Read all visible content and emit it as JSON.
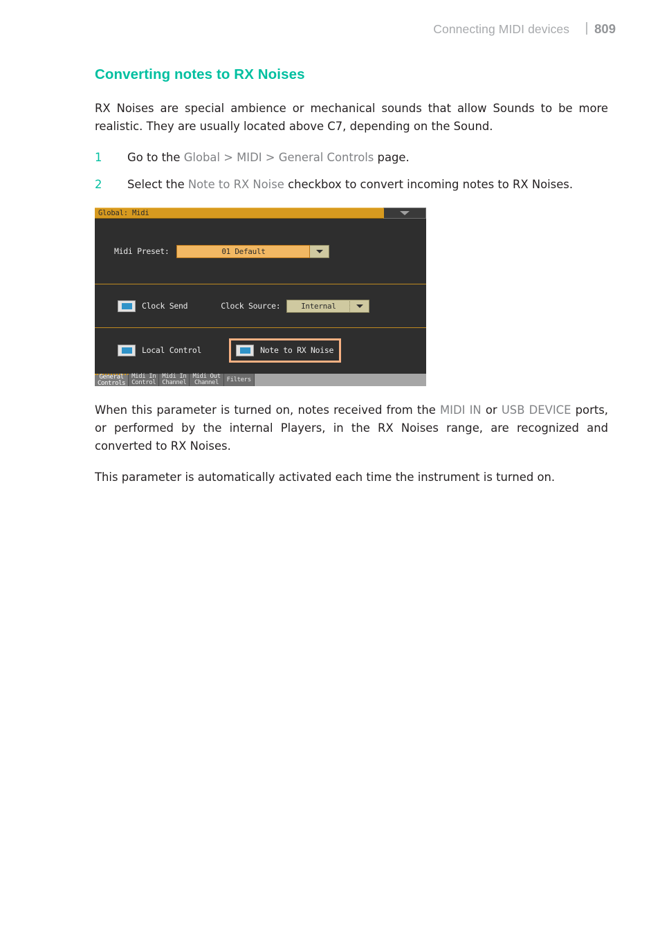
{
  "header": {
    "title": "Connecting MIDI devices",
    "page_number": "809"
  },
  "section": {
    "heading": "Converting notes to RX Noises",
    "heading_color": "#00bfa0",
    "intro": "RX Noises are special ambience or mechanical sounds that allow Sounds to be more realistic. They are usually located above C7, depending on the Sound."
  },
  "steps": [
    {
      "number": "1",
      "prefix": "Go to the ",
      "term": "Global > MIDI > General Controls",
      "suffix": " page."
    },
    {
      "number": "2",
      "prefix": "Select the ",
      "term": "Note to RX Noise",
      "suffix": " checkbox to convert incoming notes to RX Noises."
    }
  ],
  "device_screenshot": {
    "titlebar": {
      "title": "Global: Midi",
      "menu_icon": "chevron-down-icon"
    },
    "preset_row": {
      "label": "Midi Preset:",
      "value": "01 Default",
      "dropdown_icon": "chevron-down-icon"
    },
    "clock_row": {
      "clock_send": {
        "label": "Clock Send",
        "checked": true
      },
      "clock_source": {
        "label": "Clock Source:",
        "value": "Internal",
        "dropdown_icon": "chevron-down-icon"
      }
    },
    "local_row": {
      "local_control": {
        "label": "Local Control",
        "checked": true
      },
      "note_to_rx_noise": {
        "label": "Note to RX Noise",
        "checked": true,
        "highlighted": true,
        "highlight_color": "#f7b183"
      }
    },
    "tabs": [
      {
        "line1": "General",
        "line2": "Controls",
        "active": true
      },
      {
        "line1": "Midi In",
        "line2": "Control",
        "active": false
      },
      {
        "line1": "Midi In",
        "line2": "Channel",
        "active": false
      },
      {
        "line1": "Midi Out",
        "line2": "Channel",
        "active": false
      },
      {
        "line1": "Filters",
        "line2": "",
        "active": false
      }
    ]
  },
  "trailing_paragraphs": [
    {
      "part1": "When this parameter is turned on, notes received from the ",
      "term1": "MIDI IN",
      "part2": " or ",
      "term2": "USB DEVICE",
      "part3": " ports, or performed by the internal Players, in the RX Noises range, are recognized and converted to RX Noises."
    },
    {
      "text": "This parameter is automatically activated each time the instrument is turned on."
    }
  ]
}
